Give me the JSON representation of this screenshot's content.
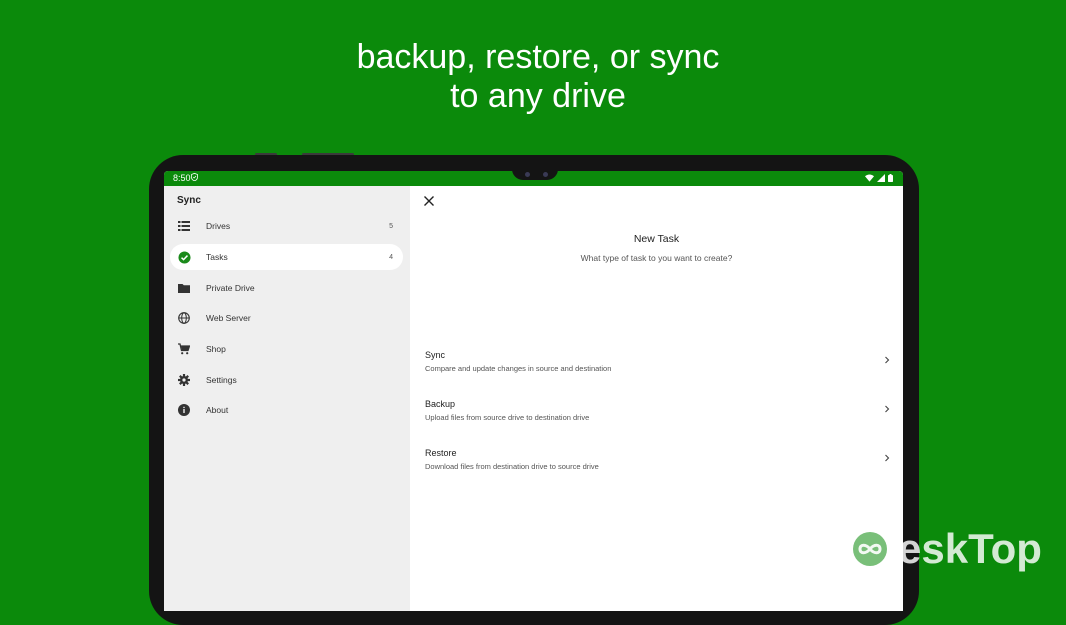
{
  "headline": {
    "line1": "backup, restore, or sync",
    "line2": "to any drive"
  },
  "status_bar": {
    "time": "8:50"
  },
  "sidebar": {
    "title": "Sync",
    "items": [
      {
        "label": "Drives",
        "count": "5",
        "icon": "list-icon"
      },
      {
        "label": "Tasks",
        "count": "4",
        "icon": "check-circle-icon",
        "active": true
      },
      {
        "label": "Private Drive",
        "icon": "folder-icon"
      },
      {
        "label": "Web Server",
        "icon": "globe-icon"
      },
      {
        "label": "Shop",
        "icon": "cart-icon"
      },
      {
        "label": "Settings",
        "icon": "gear-icon"
      },
      {
        "label": "About",
        "icon": "info-icon"
      }
    ]
  },
  "new_task": {
    "title": "New Task",
    "subtitle": "What type of task to you want to create?",
    "options": [
      {
        "title": "Sync",
        "desc": "Compare and update changes in source and destination"
      },
      {
        "title": "Backup",
        "desc": "Upload files from source drive to destination drive"
      },
      {
        "title": "Restore",
        "desc": "Download files from destination drive to source drive"
      }
    ]
  },
  "watermark": {
    "text": "eskTop"
  },
  "colors": {
    "brand_green": "#0b8a0b",
    "tasks_check": "#1a8a1a"
  }
}
